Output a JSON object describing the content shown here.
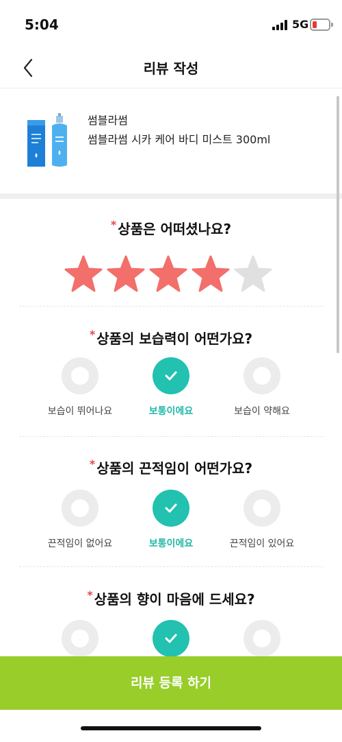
{
  "status": {
    "time": "5:04",
    "network": "5G"
  },
  "header": {
    "title": "리뷰 작성"
  },
  "product": {
    "brand": "썸블라썸",
    "name": "썸블라썸 시카 케어 바디 미스트 300ml"
  },
  "rating": {
    "question": "상품은 어떠셨나요?",
    "value": 4,
    "max": 5
  },
  "questions": [
    {
      "question": "상품의 보습력이 어떤가요?",
      "options": [
        "보습이 뛰어나요",
        "보통이에요",
        "보습이 약해요"
      ],
      "selected": 1
    },
    {
      "question": "상품의 끈적임이 어떤가요?",
      "options": [
        "끈적임이 없어요",
        "보통이에요",
        "끈적임이 있어요"
      ],
      "selected": 1
    },
    {
      "question": "상품의 향이 마음에 드세요?",
      "options": [],
      "selected": 1
    }
  ],
  "required_mark": "*",
  "submit_label": "리뷰 등록 하기",
  "colors": {
    "accent": "#22c1b0",
    "star_on": "#f26f6b",
    "star_off": "#e0e0e0",
    "submit": "#98cd2a",
    "required": "#e64848"
  }
}
